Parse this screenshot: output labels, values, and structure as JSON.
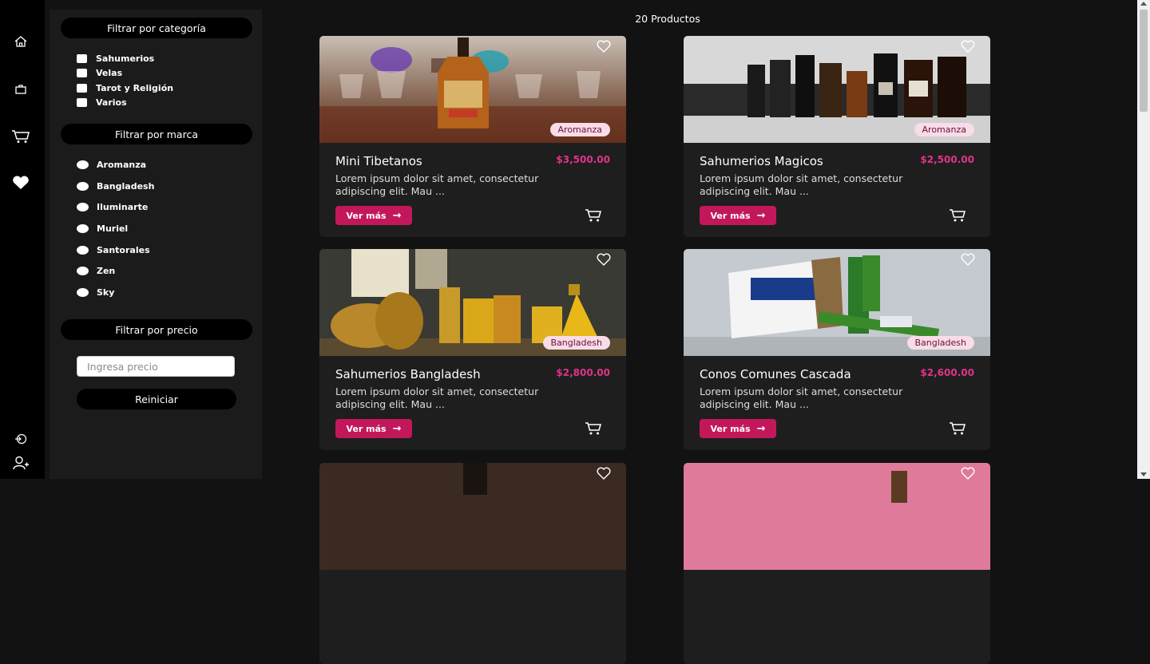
{
  "sidebar_nav": {
    "items": [
      {
        "icon": "home-icon"
      },
      {
        "icon": "shopping-bag-icon"
      },
      {
        "icon": "cart-icon"
      },
      {
        "icon": "heart-icon"
      },
      {
        "icon": "logout-icon"
      },
      {
        "icon": "add-user-icon"
      }
    ]
  },
  "filters": {
    "category": {
      "title": "Filtrar por categoría",
      "options": [
        "Sahumerios",
        "Velas",
        "Tarot y Religión",
        "Varios"
      ]
    },
    "brand": {
      "title": "Filtrar por marca",
      "options": [
        "Aromanza",
        "Bangladesh",
        "Iluminarte",
        "Muriel",
        "Santorales",
        "Zen",
        "Sky"
      ]
    },
    "price": {
      "title": "Filtrar por precio",
      "placeholder": "Ingresa precio",
      "reset_label": "Reiniciar"
    }
  },
  "products_count": "20 Productos",
  "products": [
    {
      "title": "Mini Tibetanos",
      "price": "$3,500.00",
      "brand": "Aromanza",
      "description": "Lorem ipsum dolor sit amet, consectetur adipiscing elit. Mau ...",
      "more_label": "Ver más"
    },
    {
      "title": "Sahumerios Magicos",
      "price": "$2,500.00",
      "brand": "Aromanza",
      "description": "Lorem ipsum dolor sit amet, consectetur adipiscing elit. Mau ...",
      "more_label": "Ver más"
    },
    {
      "title": "Sahumerios Bangladesh",
      "price": "$2,800.00",
      "brand": "Bangladesh",
      "description": "Lorem ipsum dolor sit amet, consectetur adipiscing elit. Mau ...",
      "more_label": "Ver más"
    },
    {
      "title": "Conos Comunes Cascada",
      "price": "$2,600.00",
      "brand": "Bangladesh",
      "description": "Lorem ipsum dolor sit amet, consectetur adipiscing elit. Mau ...",
      "more_label": "Ver más"
    },
    {
      "title": "",
      "price": "",
      "brand": "",
      "description": "",
      "more_label": ""
    },
    {
      "title": "",
      "price": "",
      "brand": "",
      "description": "",
      "more_label": ""
    }
  ],
  "colors": {
    "accent": "#c2185b",
    "price": "#e0338a",
    "brand_bg": "#f8dce8",
    "card_bg": "#1e1e1e",
    "page_bg": "#121212"
  }
}
